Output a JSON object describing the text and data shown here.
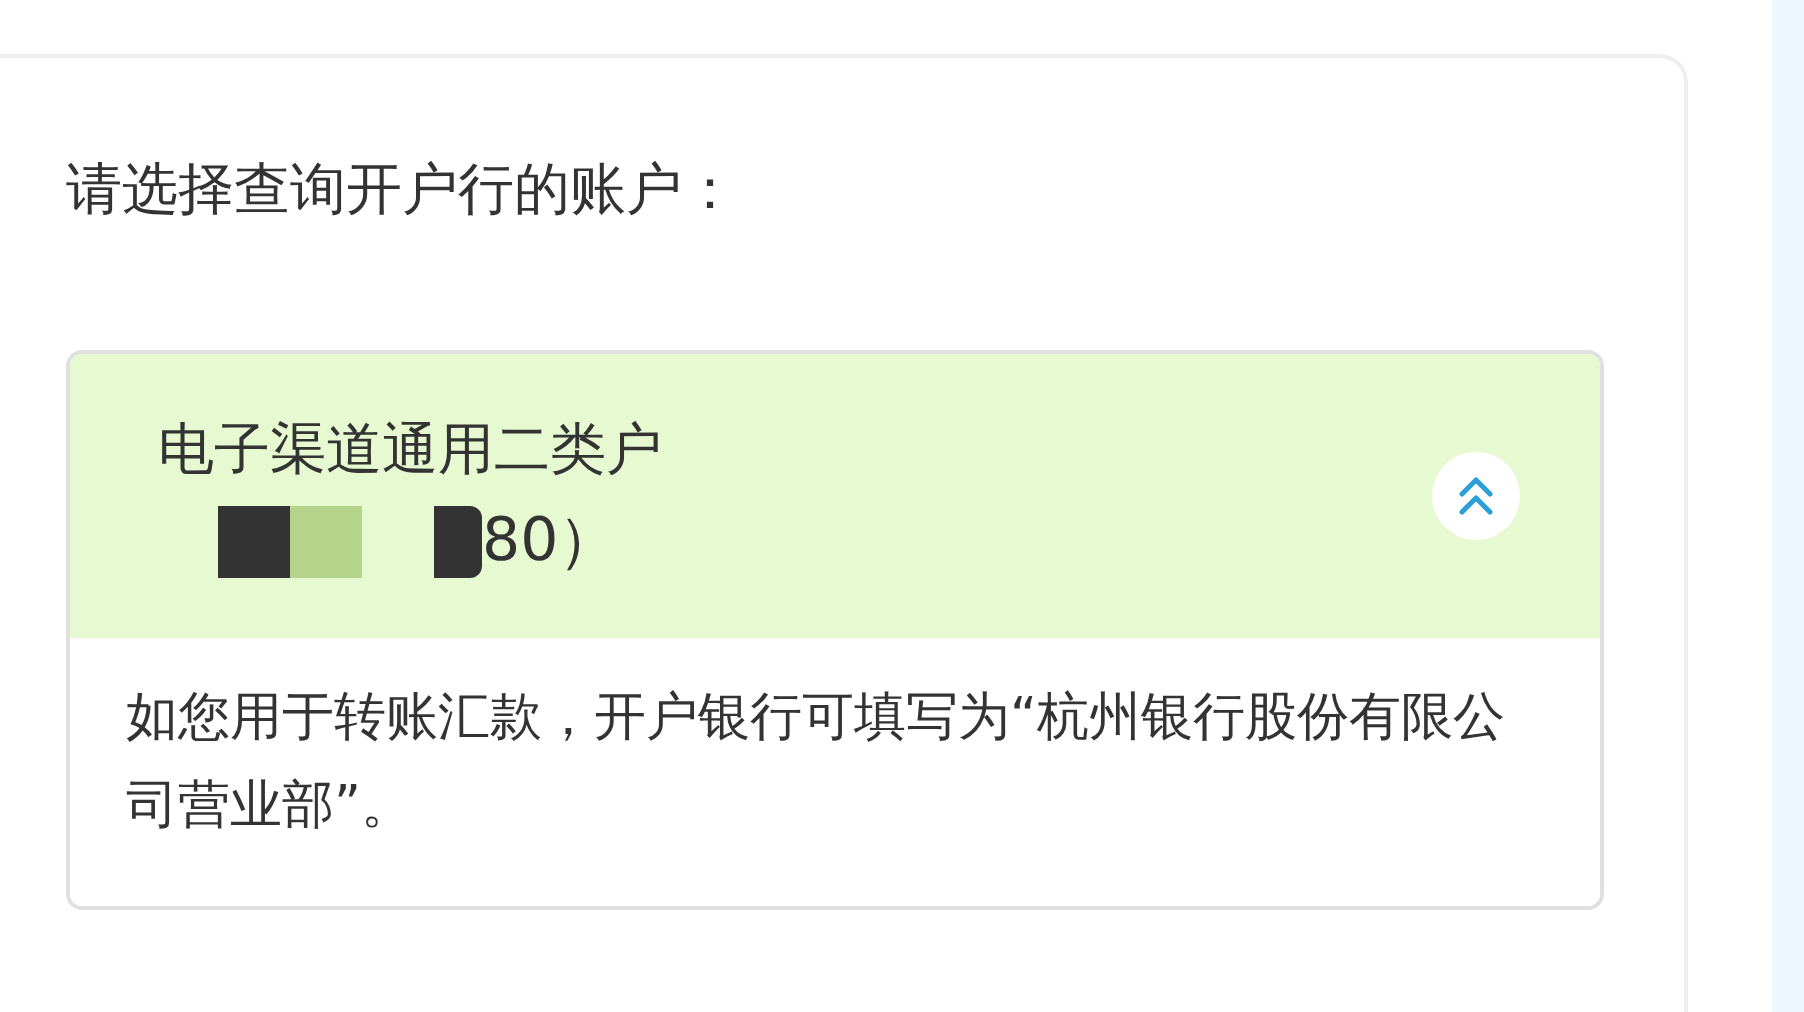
{
  "prompt": "请选择查询开户行的账户：",
  "account": {
    "name": "电子渠道通用二类户",
    "number_tail": "80）",
    "expanded": true,
    "note": "如您用于转账汇款，开户银行可填写为“杭州银行股份有限公司营业部”。"
  }
}
